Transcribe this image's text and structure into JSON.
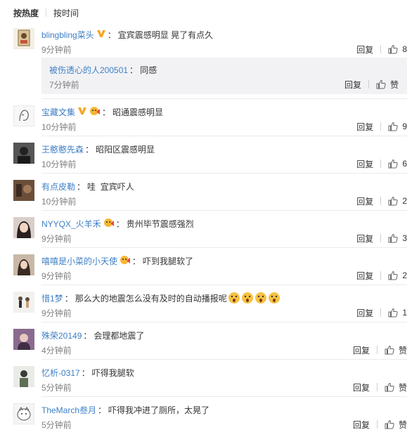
{
  "sort": {
    "hot": "按热度",
    "time": "按时间"
  },
  "labels": {
    "reply": "回复",
    "like": "赞"
  },
  "colors": {
    "link": "#3e7fc5",
    "muted": "#808080",
    "subBg": "#f2f2f5"
  },
  "comments": [
    {
      "user": "blingbling菜头",
      "badges": [
        "vip-v"
      ],
      "text": "宜宾震感明显 晃了有点久",
      "time": "9分钟前",
      "likes": "8",
      "avatar": "portrait-frame"
    },
    {
      "user": "宝藏文集",
      "badges": [
        "vip-v",
        "fan-badge"
      ],
      "text": "昭通震感明显",
      "time": "10分钟前",
      "likes": "9",
      "avatar": "sketch"
    },
    {
      "user": "王憨憨先森",
      "badges": [],
      "text": "昭阳区震感明显",
      "time": "10分钟前",
      "likes": "6",
      "avatar": "dark-photo"
    },
    {
      "user": "有点皮勒",
      "badges": [],
      "text": "哇  宜宾吓人",
      "time": "10分钟前",
      "likes": "2",
      "avatar": "brown-photo"
    },
    {
      "user": "NYYQX_火羊禾",
      "badges": [
        "fan-badge"
      ],
      "text": "贵州毕节震感强烈",
      "time": "9分钟前",
      "likes": "3",
      "avatar": "girl-photo"
    },
    {
      "user": "嘻嘻是小菜的小天使",
      "badges": [
        "fan-badge"
      ],
      "text": "吓到我腿软了",
      "time": "9分钟前",
      "likes": "2",
      "avatar": "girl-photo-2"
    },
    {
      "user": "惜1梦",
      "badges": [],
      "text": "那么大的地震怎么没有及时的自动播报呢",
      "time": "9分钟前",
      "likes": "1",
      "avatar": "figures",
      "emojis": 4
    },
    {
      "user": "殊荣20149",
      "badges": [],
      "text": "会理都地震了",
      "time": "4分钟前",
      "likes": "赞",
      "avatar": "purple-photo"
    },
    {
      "user": "忆析-0317",
      "badges": [],
      "text": "吓得我腿软",
      "time": "5分钟前",
      "likes": "赞",
      "avatar": "person-photo"
    },
    {
      "user": "TheMarch叁月",
      "badges": [],
      "text": "吓得我冲进了厕所，太晃了",
      "time": "5分钟前",
      "likes": "赞",
      "avatar": "cartoon"
    }
  ],
  "subreply": {
    "user": "被伤透心的人200501",
    "text": "同感",
    "time": "7分钟前",
    "likes": "赞"
  }
}
